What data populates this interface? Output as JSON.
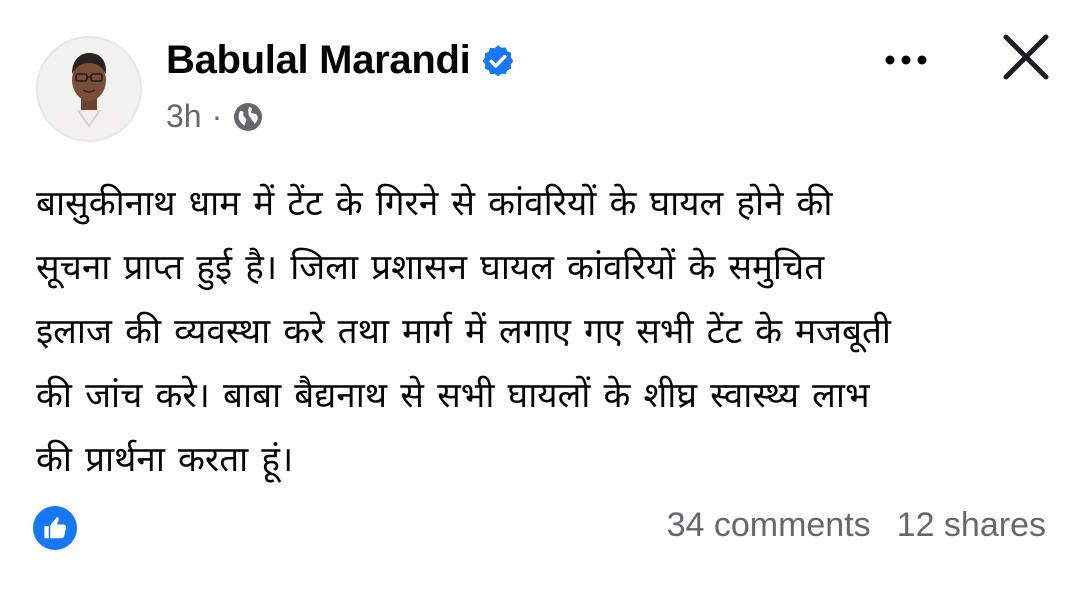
{
  "post": {
    "author": {
      "name": "Babulal Marandi",
      "verified": true,
      "avatar_icon": "profile-photo"
    },
    "meta": {
      "time": "3h",
      "separator": "·",
      "audience_icon": "globe-icon"
    },
    "header_actions": {
      "more_icon": "more-dots-icon",
      "close_icon": "close-icon"
    },
    "body_text": "बासुकीनाथ धाम में टेंट के गिरने से कांवरियों के घायल होने की\nसूचना प्राप्त हुई है। जिला प्रशासन घायल कांवरियों के समुचित\nइलाज की व्यवस्था करे तथा मार्ग में लगाए गए सभी टेंट के मजबूती\nकी जांच करे। बाबा बैद्यनाथ से सभी घायलों के शीघ्र स्वास्थ्य लाभ\nकी प्रार्थना करता  हूं।",
    "reactions": {
      "icon": "like-icon"
    },
    "stats": {
      "comments": "34 comments",
      "shares": "12 shares"
    }
  },
  "colors": {
    "text_primary": "#050505",
    "text_secondary": "#65676b",
    "accent_blue": "#1877f2",
    "background": "#ffffff"
  }
}
